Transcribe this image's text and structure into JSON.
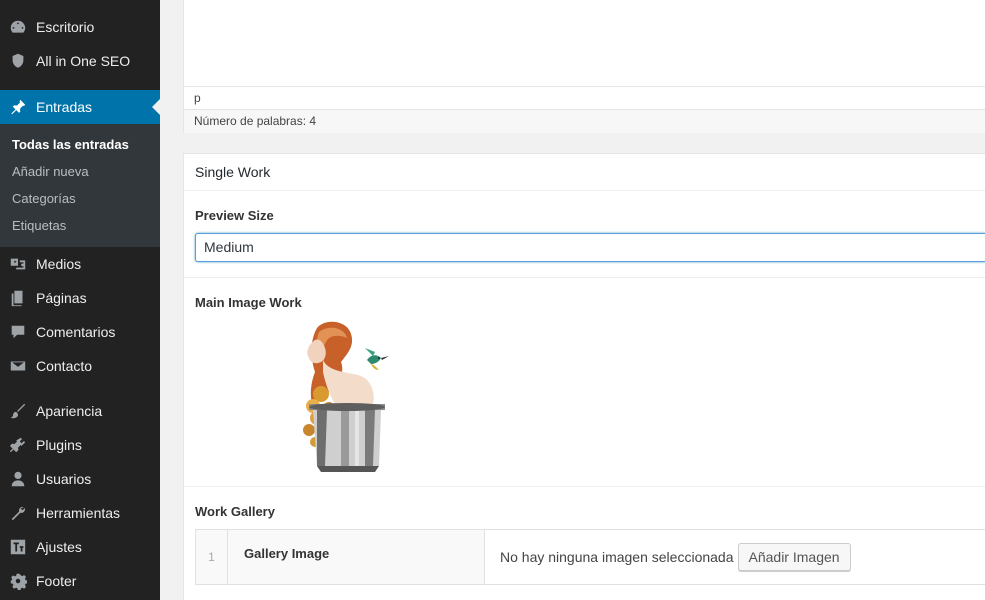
{
  "sidebar": {
    "items": [
      {
        "label": "Escritorio",
        "icon": "dashboard-icon"
      },
      {
        "label": "All in One SEO",
        "icon": "shield-icon"
      },
      {
        "label": "Entradas",
        "icon": "pin-icon",
        "active": true
      },
      {
        "label": "Medios",
        "icon": "media-icon"
      },
      {
        "label": "Páginas",
        "icon": "pages-icon"
      },
      {
        "label": "Comentarios",
        "icon": "comment-icon"
      },
      {
        "label": "Contacto",
        "icon": "mail-icon"
      },
      {
        "label": "Apariencia",
        "icon": "brush-icon"
      },
      {
        "label": "Plugins",
        "icon": "plugin-icon"
      },
      {
        "label": "Usuarios",
        "icon": "user-icon"
      },
      {
        "label": "Herramientas",
        "icon": "wrench-icon"
      },
      {
        "label": "Ajustes",
        "icon": "settings-icon"
      },
      {
        "label": "Footer",
        "icon": "gear-icon"
      }
    ],
    "submenu": [
      "Todas las entradas",
      "Añadir nueva",
      "Categorías",
      "Etiquetas"
    ]
  },
  "editor": {
    "path": "p",
    "word_count": "Número de palabras: 4"
  },
  "single_work": {
    "title": "Single Work",
    "preview_size_label": "Preview Size",
    "preview_size_value": "Medium",
    "main_image_label": "Main Image Work",
    "gallery_label": "Work Gallery",
    "gallery_row": {
      "index": "1",
      "label": "Gallery Image",
      "empty_text": "No hay ninguna imagen seleccionada",
      "button": "Añadir Imagen"
    }
  },
  "colors": {
    "sidebar_bg": "#222222",
    "submenu_bg": "#32373c",
    "accent": "#0073aa"
  }
}
